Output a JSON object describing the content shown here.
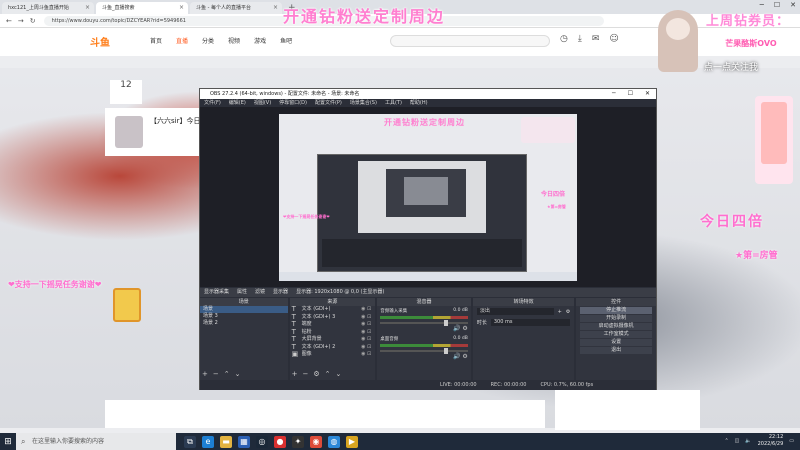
{
  "browser": {
    "tabs": [
      {
        "label": "hxc121_上周斗鱼直播开始",
        "active": false
      },
      {
        "label": "斗鱼_直播搜索",
        "active": true
      },
      {
        "label": "斗鱼 - 每个人的直播平台",
        "active": false
      }
    ],
    "url": "https://www.douyu.com/topic/DZCYEAR?rid=5949661"
  },
  "site": {
    "logo": "斗鱼",
    "nav": [
      "首页",
      "直播",
      "分类",
      "视频",
      "游戏",
      "鱼吧"
    ],
    "nav_active": 1,
    "room_title": "【六六sir】今日",
    "rank_number": "12"
  },
  "overlay": {
    "top_banner": "开通钻粉送定制周边",
    "left_text": "❤支持一下摇晃任务谢谢❤",
    "right_big": "今日四倍",
    "right_small": "★第=房管",
    "mascot_line1": "上周钻券员：",
    "mascot_line2": "芒果酪斯OVO",
    "mascot_line3": "点一点关注我"
  },
  "obs": {
    "title": "OBS 27.2.4 (64-bit, windows) - 配置文件: 未命名 - 场景: 未命名",
    "menu": [
      "文件(F)",
      "编辑(E)",
      "视图(V)",
      "停靠窗口(D)",
      "配置文件(P)",
      "场景集合(S)",
      "工具(T)",
      "帮助(H)"
    ],
    "preview_overlay_text": "开通钻粉送定制周边",
    "preview_left_text": "❤支持一下摇晃任务谢谢❤",
    "preview_right_text": "今日四倍",
    "preview_right_small": "★第=房管",
    "source_bar": [
      "显示器采集",
      "属性",
      "滤镜",
      "显示器",
      "显示器: 1920x1080 @ 0,0 (主显示器)"
    ],
    "docks": {
      "scenes": {
        "title": "场景",
        "items": [
          "场景",
          "场景 3",
          "场景 2"
        ],
        "selected": 0
      },
      "sources": {
        "title": "来源",
        "items": [
          {
            "icon": "T",
            "label": "文本 (GDI+)"
          },
          {
            "icon": "T",
            "label": "文本 (GDI+) 3"
          },
          {
            "icon": "T",
            "label": "端度"
          },
          {
            "icon": "T",
            "label": "钻粉"
          },
          {
            "icon": "T",
            "label": "大屏背景"
          },
          {
            "icon": "T",
            "label": "文本 (GDI+) 2"
          },
          {
            "icon": "▣",
            "label": "图像"
          }
        ]
      },
      "mixer": {
        "title": "混音器",
        "tracks": [
          {
            "name": "音频输入采集",
            "db": "0.0 dB"
          },
          {
            "name": "桌面音频",
            "db": "0.0 dB"
          }
        ]
      },
      "transitions": {
        "title": "转场特效",
        "type": "淡出",
        "duration_label": "时长",
        "duration": "300 ms"
      },
      "controls": {
        "title": "控件",
        "buttons": [
          "停止推流",
          "开始录制",
          "启动虚拟摄像机",
          "工作室模式",
          "设置",
          "退出"
        ],
        "active": 0
      }
    },
    "status": {
      "live": "LIVE: 00:00:00",
      "rec": "REC: 00:00:00",
      "cpu": "CPU: 0.7%, 60.00 fps"
    }
  },
  "taskbar": {
    "search_placeholder": "在这里输入你要搜索的内容",
    "time": "22:12",
    "date": "2022/6/29",
    "apps": [
      {
        "name": "task-view-icon",
        "glyph": "⧉",
        "color": "#2b3b52"
      },
      {
        "name": "edge-icon",
        "glyph": "e",
        "color": "#1d7fd3"
      },
      {
        "name": "folder-icon",
        "glyph": "▬",
        "color": "#e3b341"
      },
      {
        "name": "store-icon",
        "glyph": "▦",
        "color": "#2b5fb3"
      },
      {
        "name": "steam-icon",
        "glyph": "◎",
        "color": "#1b2838"
      },
      {
        "name": "obs-icon",
        "glyph": "●",
        "color": "#d93030"
      },
      {
        "name": "app-icon",
        "glyph": "✦",
        "color": "#333"
      },
      {
        "name": "chrome-icon",
        "glyph": "◉",
        "color": "#dd4b39"
      },
      {
        "name": "browser-icon",
        "glyph": "◍",
        "color": "#2b88d8"
      },
      {
        "name": "media-icon",
        "glyph": "▶",
        "color": "#d9a520"
      }
    ]
  }
}
